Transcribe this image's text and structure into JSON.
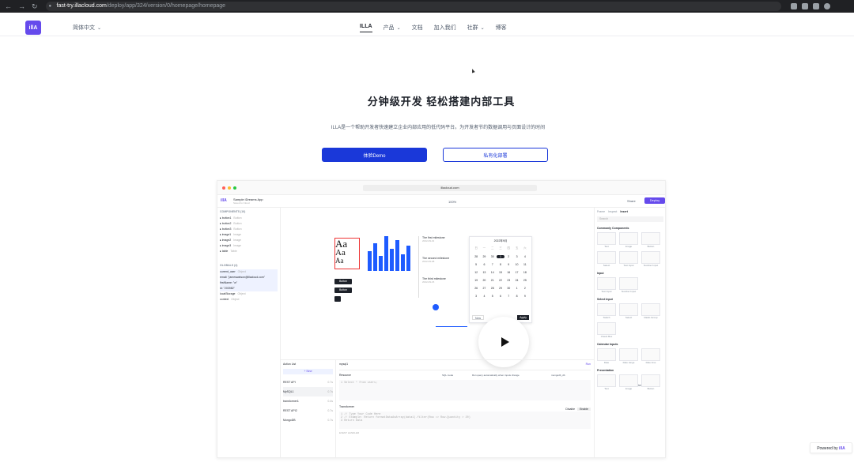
{
  "browser": {
    "url_domain": "fast-try.illacloud.com",
    "url_path": "/deploy/app/324/version/0/homepage/homepage"
  },
  "header": {
    "logo_text": "illA",
    "language": "简体中文",
    "nav": [
      {
        "label": "ILLA"
      },
      {
        "label": "产品"
      },
      {
        "label": "文档"
      },
      {
        "label": "加入我们"
      },
      {
        "label": "社群"
      },
      {
        "label": "博客"
      }
    ]
  },
  "hero": {
    "title": "分钟级开发 轻松搭建内部工具",
    "subtitle": "ILLA是一个帮助开发者快速建立企业内部应用的低代码平台。为开发者节约数据调用与页面设计的时间",
    "demo_button": "体验Demo",
    "deploy_button": "私有化部署"
  },
  "app": {
    "url": "illacloud.com",
    "logo": "illA",
    "app_name": "Sample iDreams App",
    "saved": "Saved to Cloud",
    "zoom": "100%",
    "share": "Share",
    "deploy": "Deploy",
    "components_header": "COMPONENTS (10)",
    "components": [
      {
        "name": "button1",
        "type": "Button"
      },
      {
        "name": "button2",
        "type": "Button"
      },
      {
        "name": "button3",
        "type": "Button"
      },
      {
        "name": "image1",
        "type": "Image"
      },
      {
        "name": "image2",
        "type": "Image"
      },
      {
        "name": "image3",
        "type": "Image"
      },
      {
        "name": "table",
        "type": "Table"
      }
    ],
    "globals_header": "GLOBALS (4)",
    "globals": [
      {
        "name": "current_user",
        "type": "Object"
      },
      {
        "name": "email: \"jameswatson@illacloud.com\"",
        "type": ""
      },
      {
        "name": "firstName: \"w\"",
        "type": ""
      },
      {
        "name": "id: \"203982\"",
        "type": ""
      },
      {
        "name": "localStorage",
        "type": "Object"
      },
      {
        "name": "context",
        "type": "Object"
      }
    ],
    "canvas": {
      "aa": [
        "Aa",
        "Aa",
        "Aa"
      ],
      "bar_values": [
        55,
        75,
        40,
        95,
        60,
        85,
        45,
        70
      ],
      "timeline": [
        {
          "title": "The first milestone",
          "date": "2022-09-01"
        },
        {
          "title": "The second milestone",
          "date": "2022-09-08"
        },
        {
          "title": "The third milestone",
          "date": "2022-09-15"
        }
      ],
      "button_labels": [
        "Button",
        "Button",
        "Button"
      ],
      "calendar": {
        "month": "2022年9月",
        "weekdays": [
          "日",
          "一",
          "二",
          "三",
          "四",
          "五",
          "六"
        ],
        "days": [
          "28",
          "29",
          "30",
          "1",
          "2",
          "3",
          "4",
          "5",
          "6",
          "7",
          "8",
          "9",
          "10",
          "11",
          "12",
          "13",
          "14",
          "15",
          "16",
          "17",
          "18",
          "19",
          "20",
          "21",
          "22",
          "23",
          "24",
          "25",
          "26",
          "27",
          "28",
          "29",
          "30",
          "1",
          "2",
          "3",
          "4",
          "5",
          "6",
          "7",
          "8",
          "9"
        ],
        "selected": "1",
        "now_label": "Now",
        "ok_label": "Apply"
      },
      "preview_label": "Preview"
    },
    "right_panel": {
      "tabs": [
        "Frame",
        "Inspect",
        "Insert"
      ],
      "search_placeholder": "Search",
      "sections": [
        {
          "title": "Commonly Components",
          "items": [
            "Text",
            "Image",
            "Button",
            "Select",
            "Text Input",
            "Number Input"
          ]
        },
        {
          "title": "Input",
          "items": [
            "Text Input",
            "Number Input"
          ]
        },
        {
          "title": "Select Input",
          "items": [
            "Switch",
            "Select",
            "Radio Group",
            "Check Box"
          ]
        },
        {
          "title": "Calendar Inputs",
          "items": [
            "Date",
            "Date range",
            "Date time"
          ]
        },
        {
          "title": "Presentation",
          "items": [
            "Text",
            "Image",
            "Button"
          ]
        }
      ]
    },
    "actions": {
      "title": "Action List",
      "new_label": "+ New",
      "items": [
        {
          "name": "REST API",
          "time": "0.7s"
        },
        {
          "name": "MySQL1",
          "time": "0.7s"
        },
        {
          "name": "transformer1",
          "time": "0.4s"
        },
        {
          "name": "REST API2",
          "time": "0.7s"
        },
        {
          "name": "MongoDB",
          "time": "0.7s"
        }
      ]
    },
    "query": {
      "name": "mysql1",
      "run": "Run",
      "resource_label": "Resource",
      "resource_mode": "SQL mode",
      "trigger": "Run query automatically when inputs change",
      "db": "mongodb_db",
      "sql_code": "1   Select * from users;",
      "transformer_label": "Transformer",
      "disable": "Disable",
      "enable": "Enable",
      "code_lines": [
        "1  // Type Your Code Here",
        "2  // Example: Return formatDataAsArray(data1).filter(Row => Row.Quantity > 20)",
        "3  Return Data"
      ],
      "event_handler": "EVENT HANDLER"
    }
  },
  "powered_by": {
    "prefix": "Powered by",
    "brand": "illA"
  },
  "colors": {
    "brand": "#654aec",
    "primary_button": "#1a38d9"
  }
}
